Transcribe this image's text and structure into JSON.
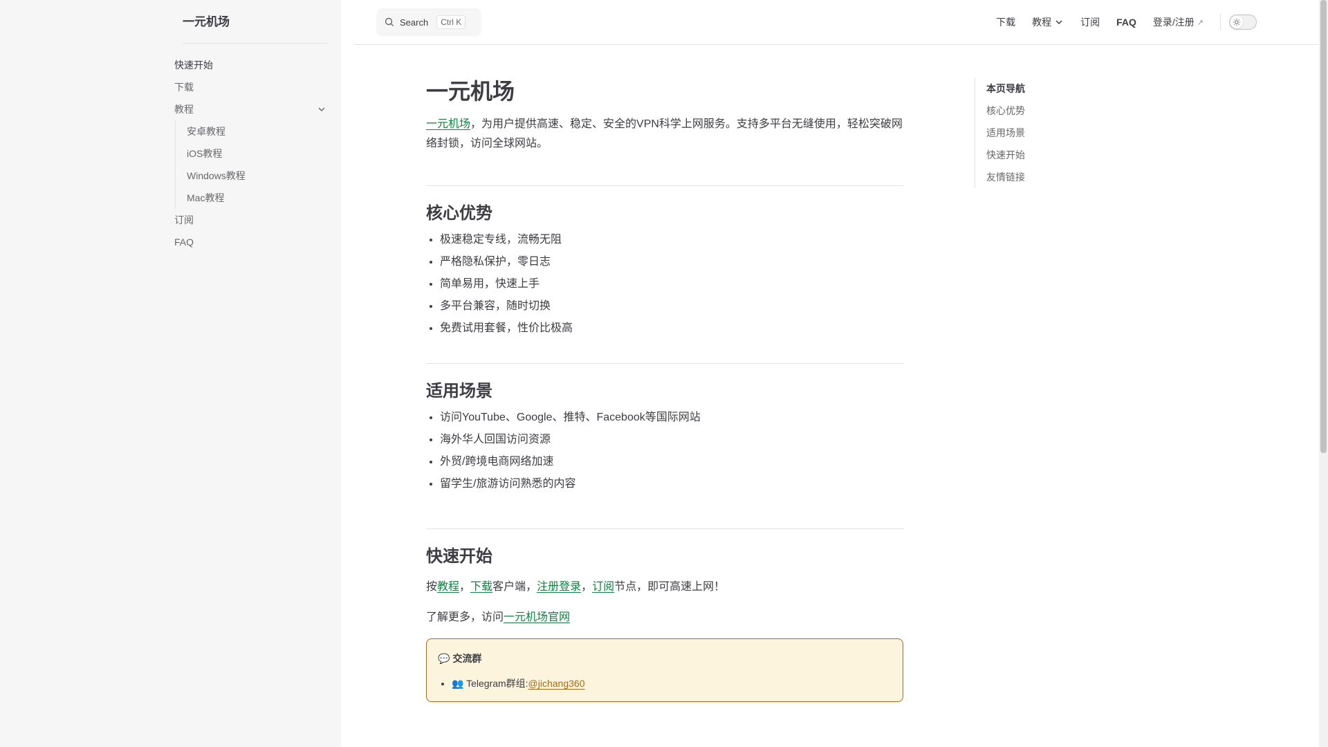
{
  "site": {
    "title": "一元机场"
  },
  "search": {
    "label": "Search",
    "shortcut": "Ctrl K"
  },
  "topnav": {
    "download": "下载",
    "tutorial": "教程",
    "subscribe": "订阅",
    "faq": "FAQ",
    "login": "登录/注册",
    "login_arrow": "↗"
  },
  "sidebar": {
    "items": [
      {
        "label": "快速开始"
      },
      {
        "label": "下载"
      },
      {
        "label": "教程"
      },
      {
        "label": "订阅"
      },
      {
        "label": "FAQ"
      }
    ],
    "tutorials": [
      "安卓教程",
      "iOS教程",
      "Windows教程",
      "Mac教程"
    ]
  },
  "main": {
    "title": "一元机场",
    "intro_link": "一元机场",
    "intro_text": "，为用户提供高速、稳定、安全的VPN科学上网服务。支持多平台无缝使用，轻松突破网络封锁，访问全球网站。",
    "sections": {
      "advantages": {
        "heading": "核心优势",
        "items": [
          "极速稳定专线，流畅无阻",
          "严格隐私保护，零日志",
          "简单易用，快速上手",
          "多平台兼容，随时切换",
          "免费试用套餐，性价比极高"
        ]
      },
      "scenarios": {
        "heading": "适用场景",
        "items": [
          "访问YouTube、Google、推特、Facebook等国际网站",
          "海外华人回国访问资源",
          "外贸/跨境电商网络加速",
          "留学生/旅游访问熟悉的内容"
        ]
      },
      "quickstart": {
        "heading": "快速开始",
        "p1_prefix": "按",
        "p1_link1": "教程",
        "p1_sep1": "，",
        "p1_link2": "下载",
        "p1_mid": "客户端，",
        "p1_link3": "注册登录",
        "p1_sep2": "，",
        "p1_link4": "订阅",
        "p1_suffix": "节点，即可高速上网！",
        "p2_prefix": "了解更多，访问",
        "p2_link": "一元机场官网"
      }
    },
    "tip": {
      "icon": "💬",
      "title": "交流群",
      "item_icon": "👥",
      "item_text": "Telegram群组:",
      "item_link": "@jichang360"
    }
  },
  "outline": {
    "title": "本页导航",
    "items": [
      "核心优势",
      "适用场景",
      "快速开始",
      "友情链接"
    ]
  },
  "colors": {
    "brand_link": "#10813f",
    "tip_border": "#a36a1a",
    "tip_bg": "#fcf4dc",
    "sidebar_bg": "#f6f6f7"
  }
}
